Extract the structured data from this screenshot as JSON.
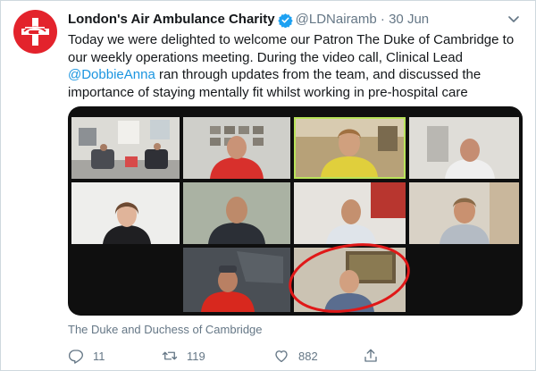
{
  "tweet": {
    "author_name": "London's Air Ambulance Charity",
    "handle": "@LDNairamb",
    "separator": "·",
    "date": "30 Jun",
    "text_lines": [
      "Today we were delighted to welcome our Patron The Duke of Cambridge to",
      "our weekly operations meeting. During the video call, Clinical Lead",
      "ran through updates from the team, and discussed the",
      "importance of staying mentally fit whilst working in pre-hospital care"
    ],
    "mention": "@DobbieAnna",
    "media_caption": "The Duke and Duchess of Cambridge",
    "replies": "11",
    "retweets": "119",
    "likes": "882"
  },
  "icons": {
    "avatar": "air-ambulance-logo",
    "verified": "verified-badge-icon",
    "menu": "chevron-down-icon",
    "reply": "reply-icon",
    "retweet": "retweet-icon",
    "like": "like-icon",
    "share": "share-icon"
  },
  "colors": {
    "brand_red": "#e3232c",
    "link_blue": "#1b95e0",
    "muted_grey": "#657786",
    "highlight_circle": "#e01818"
  }
}
